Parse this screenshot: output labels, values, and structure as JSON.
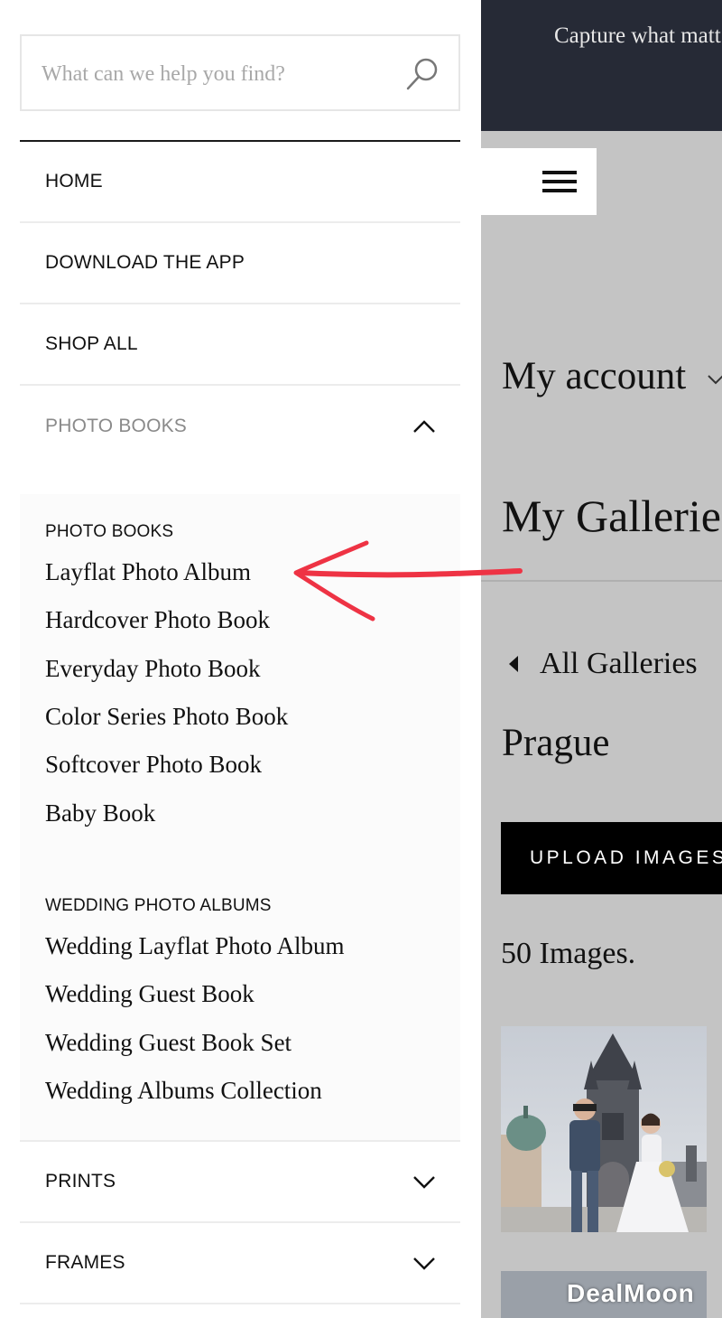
{
  "search": {
    "placeholder": "What can we help you find?"
  },
  "nav": {
    "home": "HOME",
    "download_app": "DOWNLOAD THE APP",
    "shop_all": "SHOP ALL",
    "photo_books": "PHOTO BOOKS",
    "prints": "PRINTS",
    "frames": "FRAMES"
  },
  "submenu": {
    "photo_books_heading": "PHOTO BOOKS",
    "photo_books_items": [
      "Layflat Photo Album",
      "Hardcover Photo Book",
      "Everyday Photo Book",
      "Color Series Photo Book",
      "Softcover Photo Book",
      "Baby Book"
    ],
    "wedding_heading": "WEDDING PHOTO ALBUMS",
    "wedding_items": [
      "Wedding Layflat Photo Album",
      "Wedding Guest Book",
      "Wedding Guest Book Set",
      "Wedding Albums Collection"
    ]
  },
  "page": {
    "banner_text": "Capture what matt",
    "my_account": "My account",
    "my_galleries": "My Galleries",
    "all_galleries": "All Galleries",
    "gallery_title": "Prague",
    "upload_button": "UPLOAD IMAGES",
    "image_count": "50 Images."
  },
  "watermark": "DealMoon",
  "colors": {
    "banner_bg": "#262a36",
    "page_bg": "#c4c4c4",
    "annotation_arrow": "#ee3344",
    "upload_bg": "#000000"
  },
  "icons": {
    "search": "search-icon",
    "expanded": "chevron-up-icon",
    "collapsed": "chevron-down-icon",
    "menu": "hamburger-icon",
    "back": "caret-left-icon"
  }
}
